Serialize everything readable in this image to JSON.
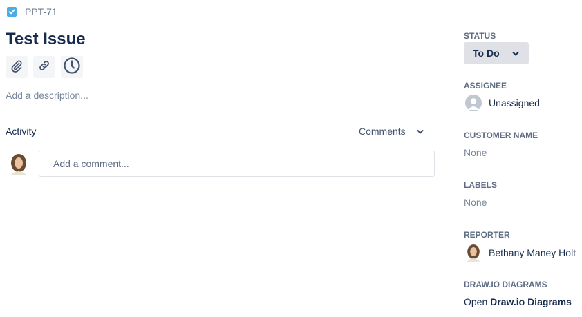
{
  "issue": {
    "key": "PPT-71",
    "title": "Test Issue",
    "description_placeholder": "Add a description..."
  },
  "activity": {
    "label": "Activity",
    "filter": "Comments",
    "comment_placeholder": "Add a comment..."
  },
  "sidebar": {
    "status": {
      "label": "STATUS",
      "value": "To Do"
    },
    "assignee": {
      "label": "ASSIGNEE",
      "value": "Unassigned"
    },
    "customer_name": {
      "label": "CUSTOMER NAME",
      "value": "None"
    },
    "labels": {
      "label": "LABELS",
      "value": "None"
    },
    "reporter": {
      "label": "REPORTER",
      "value": "Bethany Maney Holt"
    },
    "drawio": {
      "label": "DRAW.IO DIAGRAMS",
      "open": "Open",
      "link": "Draw.io Diagrams"
    }
  },
  "colors": {
    "issue_type": "#4bade8",
    "status_bg": "#dfe1e6",
    "text": "#172b4d",
    "subtle": "#5e6c84"
  },
  "icons": [
    "task-checkbox-icon",
    "attachment-icon",
    "link-icon",
    "clock-icon",
    "chevron-down-icon"
  ]
}
